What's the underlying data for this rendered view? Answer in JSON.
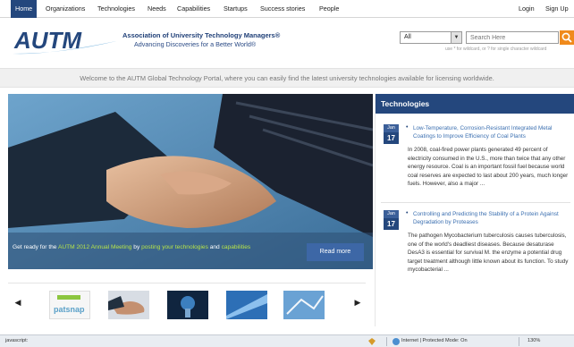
{
  "nav": {
    "items": [
      "Home",
      "Organizations",
      "Technologies",
      "Needs",
      "Capabilities",
      "Startups",
      "Success stories",
      "People"
    ],
    "login": "Login",
    "signup": "Sign Up"
  },
  "header": {
    "logo_text": "AUTM",
    "org_name": "Association of University Technology Managers®",
    "tagline": "Advancing Discoveries for a Better World®",
    "scope_select": "All",
    "search_placeholder": "Search Here",
    "search_hint": "use * for wildcard, or ? for single character wildcard"
  },
  "welcome": "Welcome to the AUTM Global Technology Portal, where you can easily find the latest university technologies available for licensing worldwide.",
  "hero": {
    "caption_prefix": "Get ready for the",
    "caption_link1": "AUTM 2012 Annual Meeting",
    "caption_mid": "by",
    "caption_link2": "posting your technologies",
    "caption_and": "and",
    "caption_link3": "capabilities",
    "read_more": "Read more"
  },
  "thumbs": {
    "first_label": "patsnap"
  },
  "sidebar": {
    "title": "Technologies",
    "items": [
      {
        "month": "Jan",
        "day": "17",
        "title": "Low-Temperature, Corrosion-Resistant Integrated Metal Coatings to Improve Efficiency of Coal Plants",
        "body": "In 2008, coal-fired power plants generated 49 percent of electricity consumed in the U.S., more than twice that any other energy resource.  Coal is an important fossil fuel because world coal reserves are expected to last about 200 years, much longer fuels.  However, also a major ..."
      },
      {
        "month": "Jan",
        "day": "17",
        "title": "Controlling and Predicting the Stability of a Protein Against Degradation by Proteases",
        "body": "The pathogen Mycobacterium tuberculosis causes tuberculosis, one of the world's deadliest diseases. Because desaturase DesA3 is essential for survival M. the enzyme a potential drug target treatment although little known about its function. To study mycobacterial ..."
      }
    ]
  },
  "statusbar": {
    "left": "javascript:",
    "zone": "Internet | Protected Mode: On",
    "zoom": "130%"
  },
  "colors": {
    "brand_blue": "#24477d",
    "search_orange": "#f08a1c",
    "link_blue": "#3b6fb0",
    "highlight_green": "#b6e34a"
  }
}
